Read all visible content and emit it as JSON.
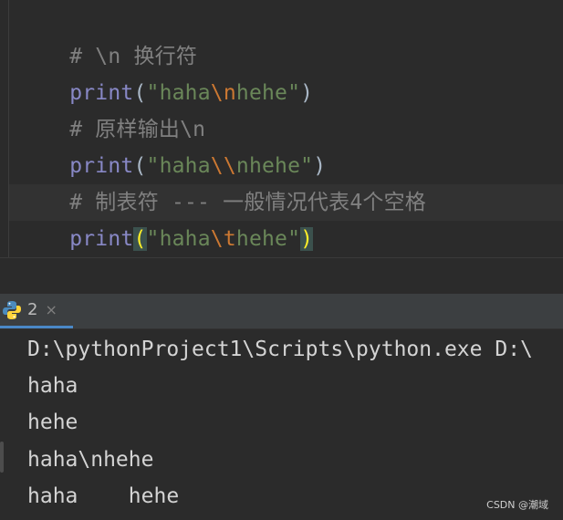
{
  "editor": {
    "line1": {
      "comment": "# \\n 换行符"
    },
    "line2": {
      "func": "print",
      "open": "(",
      "q1": "\"",
      "s1": "haha",
      "esc": "\\n",
      "s2": "hehe",
      "q2": "\"",
      "close": ")"
    },
    "line3": {
      "comment": "# 原样输出\\n"
    },
    "line4": {
      "func": "print",
      "open": "(",
      "q1": "\"",
      "s1": "haha",
      "esc": "\\\\",
      "s2": "nhehe",
      "q2": "\"",
      "close": ")"
    },
    "line5": {
      "comment": "# 制表符 --- 一般情况代表4个空格"
    },
    "line6": {
      "func": "print",
      "open": "(",
      "q1": "\"",
      "s1": "haha",
      "esc": "\\t",
      "s2": "hehe",
      "q2": "\"",
      "close": ")"
    }
  },
  "console_tab": {
    "label": "2",
    "close": "×",
    "icon": "python-icon"
  },
  "console": {
    "lines": [
      "D:\\pythonProject1\\Scripts\\python.exe D:\\",
      "haha",
      "hehe",
      "haha\\nhehe",
      "haha    hehe"
    ]
  },
  "watermark": "CSDN @潮域",
  "colors": {
    "background": "#2b2b2b",
    "keyword": "#8888c6",
    "string": "#6a8759",
    "escape": "#cc7832",
    "comment": "#808080",
    "bracket_match": "#ffef28",
    "tab_accent": "#4a88c7"
  }
}
